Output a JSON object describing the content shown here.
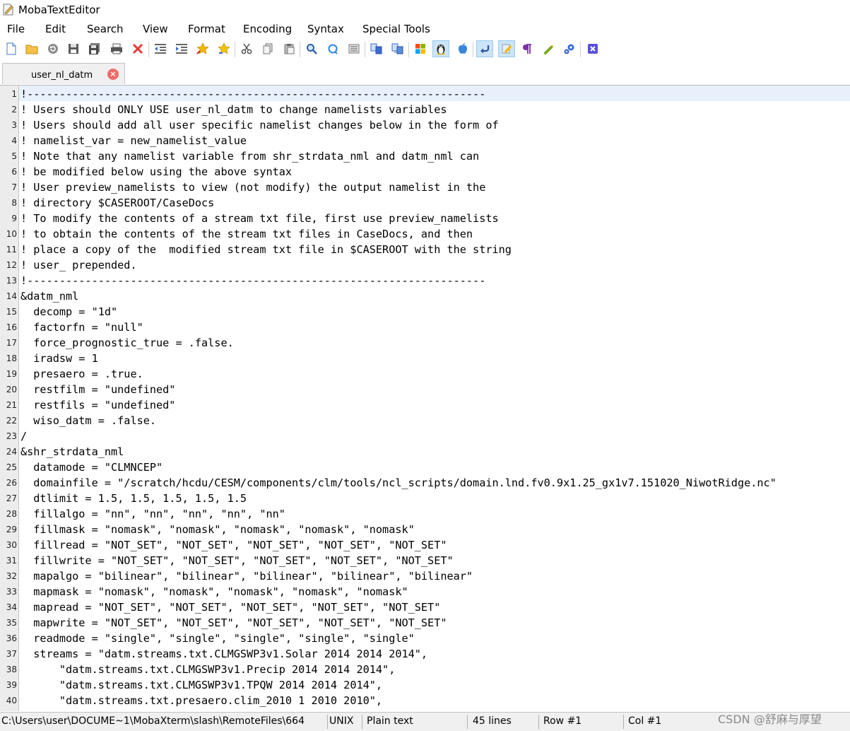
{
  "window": {
    "title": "MobaTextEditor"
  },
  "menu": [
    "File",
    "Edit",
    "Search",
    "View",
    "Format",
    "Encoding",
    "Syntax",
    "Special Tools"
  ],
  "toolbar_icons": [
    "new-file-icon",
    "open-folder-icon",
    "reload-icon",
    "save-icon",
    "save-all-icon",
    "print-icon",
    "close-file-icon",
    "decrease-indent-icon",
    "increase-indent-icon",
    "bookmark-icon",
    "bookmark-next-icon",
    "cut-icon",
    "copy-icon",
    "paste-icon",
    "find-icon",
    "replace-icon",
    "goto-icon",
    "compare-icon",
    "sync-icon",
    "windows-eol-icon",
    "linux-eol-icon",
    "mac-eol-icon",
    "word-wrap-icon",
    "highlight-icon",
    "show-paragraph-icon",
    "pen-icon",
    "settings-icon",
    "exit-icon"
  ],
  "colors": {
    "accent": "#3a6bd6",
    "close": "#e53935",
    "cursor_row": "#e8f1fb",
    "gutter": "#ececec"
  },
  "tab": {
    "label": "user_nl_datm",
    "close_glyph": "×"
  },
  "editor": {
    "lines": [
      {
        "n": "1",
        "text": "!-----------------------------------------------------------------------"
      },
      {
        "n": "2",
        "text": "! Users should ONLY USE user_nl_datm to change namelists variables"
      },
      {
        "n": "3",
        "text": "! Users should add all user specific namelist changes below in the form of"
      },
      {
        "n": "4",
        "text": "! namelist_var = new_namelist_value"
      },
      {
        "n": "5",
        "text": "! Note that any namelist variable from shr_strdata_nml and datm_nml can"
      },
      {
        "n": "6",
        "text": "! be modified below using the above syntax"
      },
      {
        "n": "7",
        "text": "! User preview_namelists to view (not modify) the output namelist in the"
      },
      {
        "n": "8",
        "text": "! directory $CASEROOT/CaseDocs"
      },
      {
        "n": "9",
        "text": "! To modify the contents of a stream txt file, first use preview_namelists"
      },
      {
        "n": "10",
        "text": "! to obtain the contents of the stream txt files in CaseDocs, and then"
      },
      {
        "n": "11",
        "text": "! place a copy of the  modified stream txt file in $CASEROOT with the string"
      },
      {
        "n": "12",
        "text": "! user_ prepended."
      },
      {
        "n": "13",
        "text": "!-----------------------------------------------------------------------"
      },
      {
        "n": "14",
        "text": "&datm_nml"
      },
      {
        "n": "15",
        "text": "  decomp = \"1d\""
      },
      {
        "n": "16",
        "text": "  factorfn = \"null\""
      },
      {
        "n": "17",
        "text": "  force_prognostic_true = .false."
      },
      {
        "n": "18",
        "text": "  iradsw = 1"
      },
      {
        "n": "19",
        "text": "  presaero = .true."
      },
      {
        "n": "20",
        "text": "  restfilm = \"undefined\""
      },
      {
        "n": "21",
        "text": "  restfils = \"undefined\""
      },
      {
        "n": "22",
        "text": "  wiso_datm = .false."
      },
      {
        "n": "23",
        "text": "/"
      },
      {
        "n": "24",
        "text": "&shr_strdata_nml"
      },
      {
        "n": "25",
        "text": "  datamode = \"CLMNCEP\""
      },
      {
        "n": "26",
        "text": "  domainfile = \"/scratch/hcdu/CESM/components/clm/tools/ncl_scripts/domain.lnd.fv0.9x1.25_gx1v7.151020_NiwotRidge.nc\""
      },
      {
        "n": "27",
        "text": "  dtlimit = 1.5, 1.5, 1.5, 1.5, 1.5"
      },
      {
        "n": "28",
        "text": "  fillalgo = \"nn\", \"nn\", \"nn\", \"nn\", \"nn\""
      },
      {
        "n": "29",
        "text": "  fillmask = \"nomask\", \"nomask\", \"nomask\", \"nomask\", \"nomask\""
      },
      {
        "n": "30",
        "text": "  fillread = \"NOT_SET\", \"NOT_SET\", \"NOT_SET\", \"NOT_SET\", \"NOT_SET\""
      },
      {
        "n": "31",
        "text": "  fillwrite = \"NOT_SET\", \"NOT_SET\", \"NOT_SET\", \"NOT_SET\", \"NOT_SET\""
      },
      {
        "n": "32",
        "text": "  mapalgo = \"bilinear\", \"bilinear\", \"bilinear\", \"bilinear\", \"bilinear\""
      },
      {
        "n": "33",
        "text": "  mapmask = \"nomask\", \"nomask\", \"nomask\", \"nomask\", \"nomask\""
      },
      {
        "n": "34",
        "text": "  mapread = \"NOT_SET\", \"NOT_SET\", \"NOT_SET\", \"NOT_SET\", \"NOT_SET\""
      },
      {
        "n": "35",
        "text": "  mapwrite = \"NOT_SET\", \"NOT_SET\", \"NOT_SET\", \"NOT_SET\", \"NOT_SET\""
      },
      {
        "n": "36",
        "text": "  readmode = \"single\", \"single\", \"single\", \"single\", \"single\""
      },
      {
        "n": "37",
        "text": "  streams = \"datm.streams.txt.CLMGSWP3v1.Solar 2014 2014 2014\","
      },
      {
        "n": "38",
        "text": "      \"datm.streams.txt.CLMGSWP3v1.Precip 2014 2014 2014\","
      },
      {
        "n": "39",
        "text": "      \"datm.streams.txt.CLMGSWP3v1.TPQW 2014 2014 2014\","
      },
      {
        "n": "40",
        "text": "      \"datm.streams.txt.presaero.clim_2010 1 2010 2010\","
      }
    ]
  },
  "status": {
    "path": "C:\\Users\\user\\DOCUME~1\\MobaXterm\\slash\\RemoteFiles\\664",
    "eol": "UNIX",
    "syntax": "Plain text",
    "lines": "45 lines",
    "row": "Row #1",
    "col": "Col #1"
  },
  "watermark": "CSDN @舒麻与厚望"
}
